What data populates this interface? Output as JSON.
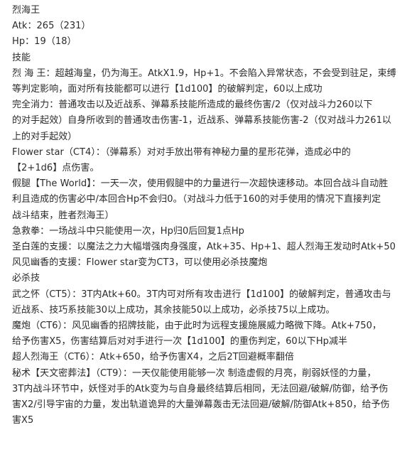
{
  "document": {
    "lines": [
      "烈海王",
      "Atk：265（231）",
      "Hp：19（18）",
      "技能",
      "烈 海 王：超越海皇，仍为海王。AtkX1.9，Hp+1。不会陷入异常状态，不会受到驻足，束缚",
      "等判定影响，面对所有技能都可以进行【1d100】的破解判定，60以上成功",
      "完全消力：普通攻击以及近战系、弹幕系技能所造成的最终伤害/2（仅对战斗力260以下",
      "的对手起效）自身所收到的普通攻击伤害-1，近战系、弹幕系技能伤害-2（仅对战斗力261以",
      "上的对手起效）",
      "Flower star（CT4）：（弹幕系）对对手放出带有神秘力量的星形花弹，造成必中的",
      "【2+1d6】点伤害。",
      "假腿【The World】：一天一次，使用假腿中的力量进行一次超快速移动。本回合战斗自动胜",
      "利且造成的伤害必中/本回合Hp不会归0。（对战斗力低于160的对手使用的情况下直接判定",
      "战斗结束，胜者烈海王）",
      "急救拳：一场战斗中只能使用一次，Hp归0后回复1点Hp",
      "圣白莲的支援：以魔法之力大幅增强肉身强度，Atk+35、Hp+1、超人烈海王发动时Atk+50",
      "风见幽香的支援：Flower star变为CT3，可以使用必杀技魔炮",
      "必杀技",
      "武之怀（CT5）：3T内Atk+60。3T内可对所有攻击进行【1d100】的破解判定，普通攻击与",
      "近战系、技巧系技能30以上成功，其余技能50以上成功，必杀技75以上成功。",
      "魔炮（CT6）：风见幽香的招牌技能，由于此时为远程支援施展威力略微下降。Atk+750，",
      "给予伤害X5，伤害结算后对对手进行一次【1d100】的重伤判定，60以下Hp减半",
      "超人烈海王（CT6）：Atk+650，给予伤害X4，之后2T回避概率翻倍",
      "秘术【天文密葬法】（CT9）：一天仅能使用能够一次 制造虚假的月亮，削弱妖怪的力量，",
      "3T内战斗环节中，妖怪对手的Atk变为与自身最终结算后相同，无法回避/破解/防御，给予伤",
      "害X2/引导宇宙的力量，发出轨道诡异的大量弹幕轰击无法回避/破解/防御Atk+850，给予伤",
      "害X5"
    ]
  },
  "colors": {
    "text": "#2b2b2b",
    "background": "#ffffff"
  }
}
